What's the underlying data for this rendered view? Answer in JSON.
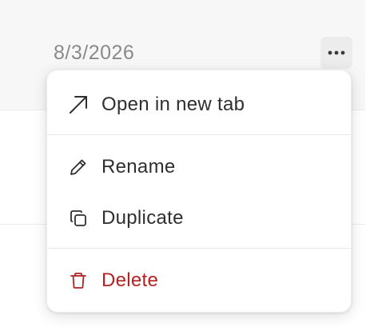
{
  "row": {
    "date": "8/3/2026",
    "more_icon": "ellipsis-horizontal-icon"
  },
  "menu": {
    "items": [
      {
        "label": "Open in new tab",
        "icon": "external-arrow-icon"
      },
      {
        "label": "Rename",
        "icon": "pencil-icon"
      },
      {
        "label": "Duplicate",
        "icon": "duplicate-icon"
      },
      {
        "label": "Delete",
        "icon": "trash-icon",
        "danger": true
      }
    ]
  },
  "colors": {
    "row_background": "#f7f7f7",
    "date_text": "#8a8a8a",
    "menu_text": "#2f2f2f",
    "danger": "#b42121"
  }
}
